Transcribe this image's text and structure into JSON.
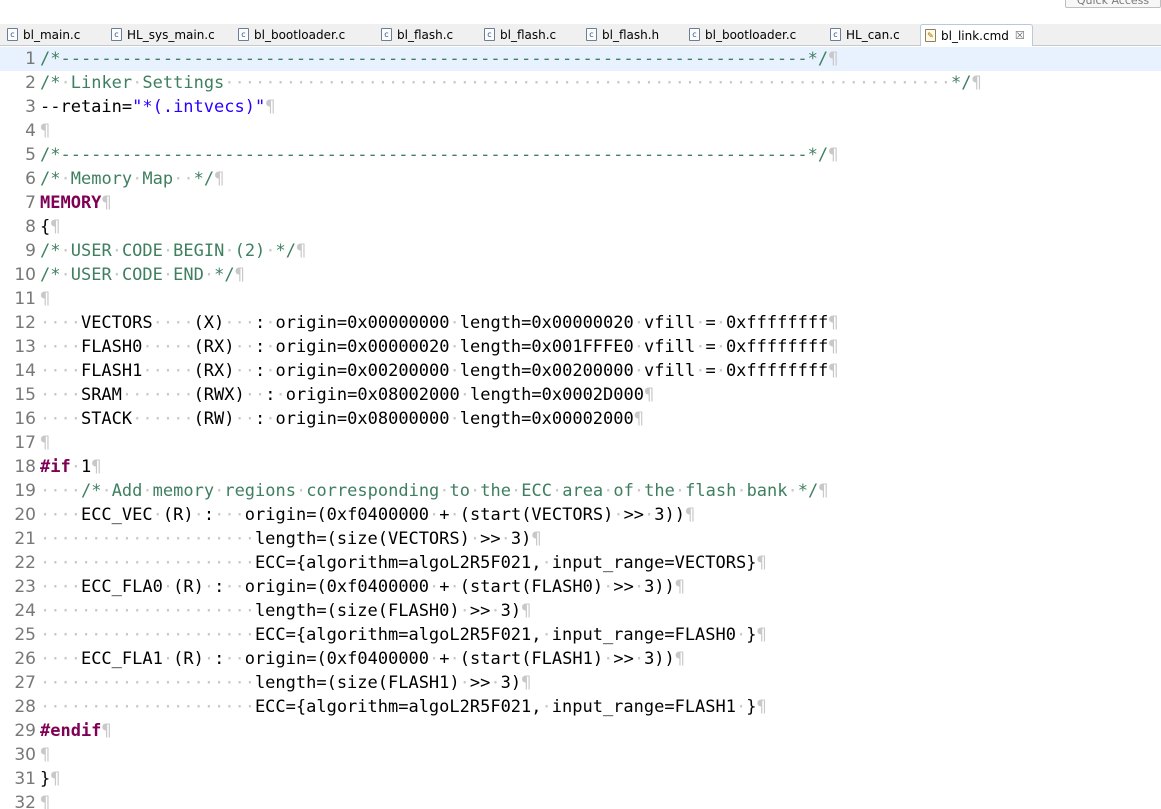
{
  "quick_access": {
    "label": "Quick Access"
  },
  "tabs": [
    {
      "label": "bl_main.c",
      "type": "c"
    },
    {
      "label": "HL_sys_main.c",
      "type": "c"
    },
    {
      "label": "bl_bootloader.c",
      "type": "c"
    },
    {
      "label": "bl_flash.c",
      "type": "c"
    },
    {
      "label": "bl_flash.c",
      "type": "c"
    },
    {
      "label": "bl_flash.h",
      "type": "h"
    },
    {
      "label": "bl_bootloader.c",
      "type": "c"
    },
    {
      "label": "HL_can.c",
      "type": "c"
    },
    {
      "label": "bl_link.cmd",
      "type": "cmd",
      "active": true,
      "close": "☒"
    }
  ],
  "colors": {
    "comment": "#3f7f5f",
    "keyword": "#7f0055",
    "string": "#2a00ff",
    "whitespace_marker": "#c8c8c8",
    "line_number": "#787878",
    "current_line": "#e8f2fe"
  },
  "editor": {
    "lines": [
      {
        "n": "1",
        "segs": [
          [
            "/*-------------------------------------------------------------------------*/",
            "cm"
          ]
        ]
      },
      {
        "n": "2",
        "segs": [
          [
            "/*",
            "cm"
          ],
          [
            "·",
            "ws"
          ],
          [
            "Linker",
            "cm"
          ],
          [
            "·",
            "ws"
          ],
          [
            "Settings",
            "cm"
          ],
          [
            "·······································································",
            "ws"
          ],
          [
            "*/",
            "cm"
          ]
        ]
      },
      {
        "n": "3",
        "segs": [
          [
            "--retain=",
            ""
          ],
          [
            "\"*(.intvecs)\"",
            "str"
          ]
        ]
      },
      {
        "n": "4",
        "segs": []
      },
      {
        "n": "5",
        "segs": [
          [
            "/*-------------------------------------------------------------------------*/",
            "cm"
          ]
        ]
      },
      {
        "n": "6",
        "segs": [
          [
            "/*",
            "cm"
          ],
          [
            "·",
            "ws"
          ],
          [
            "Memory",
            "cm"
          ],
          [
            "·",
            "ws"
          ],
          [
            "Map",
            "cm"
          ],
          [
            "··",
            "ws"
          ],
          [
            "*/",
            "cm"
          ]
        ]
      },
      {
        "n": "7",
        "segs": [
          [
            "MEMORY",
            "kw"
          ]
        ]
      },
      {
        "n": "8",
        "segs": [
          [
            "{",
            ""
          ]
        ]
      },
      {
        "n": "9",
        "segs": [
          [
            "/*",
            "cm"
          ],
          [
            "·",
            "ws"
          ],
          [
            "USER",
            "cm"
          ],
          [
            "·",
            "ws"
          ],
          [
            "CODE",
            "cm"
          ],
          [
            "·",
            "ws"
          ],
          [
            "BEGIN",
            "cm"
          ],
          [
            "·",
            "ws"
          ],
          [
            "(2)",
            "cm"
          ],
          [
            "·",
            "ws"
          ],
          [
            "*/",
            "cm"
          ]
        ]
      },
      {
        "n": "10",
        "segs": [
          [
            "/*",
            "cm"
          ],
          [
            "·",
            "ws"
          ],
          [
            "USER",
            "cm"
          ],
          [
            "·",
            "ws"
          ],
          [
            "CODE",
            "cm"
          ],
          [
            "·",
            "ws"
          ],
          [
            "END",
            "cm"
          ],
          [
            "·",
            "ws"
          ],
          [
            "*/",
            "cm"
          ]
        ]
      },
      {
        "n": "11",
        "segs": []
      },
      {
        "n": "12",
        "segs": [
          [
            "····",
            "ws"
          ],
          [
            "VECTORS",
            ""
          ],
          [
            "····",
            "ws"
          ],
          [
            "(X)",
            ""
          ],
          [
            "···",
            "ws"
          ],
          [
            ":",
            ""
          ],
          [
            "·",
            "ws"
          ],
          [
            "origin=0x00000000",
            ""
          ],
          [
            "·",
            "ws"
          ],
          [
            "length=0x00000020",
            ""
          ],
          [
            "·",
            "ws"
          ],
          [
            "vfill",
            ""
          ],
          [
            "·",
            "ws"
          ],
          [
            "=",
            ""
          ],
          [
            "·",
            "ws"
          ],
          [
            "0xffffffff",
            ""
          ]
        ]
      },
      {
        "n": "13",
        "segs": [
          [
            "····",
            "ws"
          ],
          [
            "FLASH0",
            ""
          ],
          [
            "·····",
            "ws"
          ],
          [
            "(RX)",
            ""
          ],
          [
            "··",
            "ws"
          ],
          [
            ":",
            ""
          ],
          [
            "·",
            "ws"
          ],
          [
            "origin=0x00000020",
            ""
          ],
          [
            "·",
            "ws"
          ],
          [
            "length=0x001FFFE0",
            ""
          ],
          [
            "·",
            "ws"
          ],
          [
            "vfill",
            ""
          ],
          [
            "·",
            "ws"
          ],
          [
            "=",
            ""
          ],
          [
            "·",
            "ws"
          ],
          [
            "0xffffffff",
            ""
          ]
        ]
      },
      {
        "n": "14",
        "segs": [
          [
            "····",
            "ws"
          ],
          [
            "FLASH1",
            ""
          ],
          [
            "·····",
            "ws"
          ],
          [
            "(RX)",
            ""
          ],
          [
            "··",
            "ws"
          ],
          [
            ":",
            ""
          ],
          [
            "·",
            "ws"
          ],
          [
            "origin=0x00200000",
            ""
          ],
          [
            "·",
            "ws"
          ],
          [
            "length=0x00200000",
            ""
          ],
          [
            "·",
            "ws"
          ],
          [
            "vfill",
            ""
          ],
          [
            "·",
            "ws"
          ],
          [
            "=",
            ""
          ],
          [
            "·",
            "ws"
          ],
          [
            "0xffffffff",
            ""
          ]
        ]
      },
      {
        "n": "15",
        "segs": [
          [
            "····",
            "ws"
          ],
          [
            "SRAM",
            ""
          ],
          [
            "·······",
            "ws"
          ],
          [
            "(RWX)",
            ""
          ],
          [
            "··",
            "ws"
          ],
          [
            ":",
            ""
          ],
          [
            "·",
            "ws"
          ],
          [
            "origin=0x08002000",
            ""
          ],
          [
            "·",
            "ws"
          ],
          [
            "length=0x0002D000",
            ""
          ]
        ]
      },
      {
        "n": "16",
        "segs": [
          [
            "····",
            "ws"
          ],
          [
            "STACK",
            ""
          ],
          [
            "······",
            "ws"
          ],
          [
            "(RW)",
            ""
          ],
          [
            "··",
            "ws"
          ],
          [
            ":",
            ""
          ],
          [
            "·",
            "ws"
          ],
          [
            "origin=0x08000000",
            ""
          ],
          [
            "·",
            "ws"
          ],
          [
            "length=0x00002000",
            ""
          ]
        ]
      },
      {
        "n": "17",
        "segs": []
      },
      {
        "n": "18",
        "segs": [
          [
            "#if",
            "kw"
          ],
          [
            "·",
            "ws"
          ],
          [
            "1",
            ""
          ]
        ]
      },
      {
        "n": "19",
        "segs": [
          [
            "····",
            "ws"
          ],
          [
            "/*",
            "cm"
          ],
          [
            "·",
            "ws"
          ],
          [
            "Add",
            "cm"
          ],
          [
            "·",
            "ws"
          ],
          [
            "memory",
            "cm"
          ],
          [
            "·",
            "ws"
          ],
          [
            "regions",
            "cm"
          ],
          [
            "·",
            "ws"
          ],
          [
            "corresponding",
            "cm"
          ],
          [
            "·",
            "ws"
          ],
          [
            "to",
            "cm"
          ],
          [
            "·",
            "ws"
          ],
          [
            "the",
            "cm"
          ],
          [
            "·",
            "ws"
          ],
          [
            "ECC",
            "cm"
          ],
          [
            "·",
            "ws"
          ],
          [
            "area",
            "cm"
          ],
          [
            "·",
            "ws"
          ],
          [
            "of",
            "cm"
          ],
          [
            "·",
            "ws"
          ],
          [
            "the",
            "cm"
          ],
          [
            "·",
            "ws"
          ],
          [
            "flash",
            "cm"
          ],
          [
            "·",
            "ws"
          ],
          [
            "bank",
            "cm"
          ],
          [
            "·",
            "ws"
          ],
          [
            "*/",
            "cm"
          ]
        ]
      },
      {
        "n": "20",
        "segs": [
          [
            "····",
            "ws"
          ],
          [
            "ECC_VEC",
            ""
          ],
          [
            "·",
            "ws"
          ],
          [
            "(R)",
            ""
          ],
          [
            "·",
            "ws"
          ],
          [
            ":",
            ""
          ],
          [
            "···",
            "ws"
          ],
          [
            "origin=(0xf0400000",
            ""
          ],
          [
            "·",
            "ws"
          ],
          [
            "+",
            ""
          ],
          [
            "·",
            "ws"
          ],
          [
            "(start(VECTORS)",
            ""
          ],
          [
            "·",
            "ws"
          ],
          [
            ">>",
            ""
          ],
          [
            "·",
            "ws"
          ],
          [
            "3))",
            ""
          ]
        ]
      },
      {
        "n": "21",
        "segs": [
          [
            "·····················",
            "ws"
          ],
          [
            "length=(size(VECTORS)",
            ""
          ],
          [
            "·",
            "ws"
          ],
          [
            ">>",
            ""
          ],
          [
            "·",
            "ws"
          ],
          [
            "3)",
            ""
          ]
        ]
      },
      {
        "n": "22",
        "segs": [
          [
            "·····················",
            "ws"
          ],
          [
            "ECC={algorithm=algoL2R5F021,",
            ""
          ],
          [
            "·",
            "ws"
          ],
          [
            "input_range=VECTORS}",
            ""
          ]
        ]
      },
      {
        "n": "23",
        "segs": [
          [
            "····",
            "ws"
          ],
          [
            "ECC_FLA0",
            ""
          ],
          [
            "·",
            "ws"
          ],
          [
            "(R)",
            ""
          ],
          [
            "·",
            "ws"
          ],
          [
            ":",
            ""
          ],
          [
            "··",
            "ws"
          ],
          [
            "origin=(0xf0400000",
            ""
          ],
          [
            "·",
            "ws"
          ],
          [
            "+",
            ""
          ],
          [
            "·",
            "ws"
          ],
          [
            "(start(FLASH0)",
            ""
          ],
          [
            "·",
            "ws"
          ],
          [
            ">>",
            ""
          ],
          [
            "·",
            "ws"
          ],
          [
            "3))",
            ""
          ]
        ]
      },
      {
        "n": "24",
        "segs": [
          [
            "·····················",
            "ws"
          ],
          [
            "length=(size(FLASH0)",
            ""
          ],
          [
            "·",
            "ws"
          ],
          [
            ">>",
            ""
          ],
          [
            "·",
            "ws"
          ],
          [
            "3)",
            ""
          ]
        ]
      },
      {
        "n": "25",
        "segs": [
          [
            "·····················",
            "ws"
          ],
          [
            "ECC={algorithm=algoL2R5F021,",
            ""
          ],
          [
            "·",
            "ws"
          ],
          [
            "input_range=FLASH0",
            ""
          ],
          [
            "·",
            "ws"
          ],
          [
            "}",
            ""
          ]
        ]
      },
      {
        "n": "26",
        "segs": [
          [
            "····",
            "ws"
          ],
          [
            "ECC_FLA1",
            ""
          ],
          [
            "·",
            "ws"
          ],
          [
            "(R)",
            ""
          ],
          [
            "·",
            "ws"
          ],
          [
            ":",
            ""
          ],
          [
            "··",
            "ws"
          ],
          [
            "origin=(0xf0400000",
            ""
          ],
          [
            "·",
            "ws"
          ],
          [
            "+",
            ""
          ],
          [
            "·",
            "ws"
          ],
          [
            "(start(FLASH1)",
            ""
          ],
          [
            "·",
            "ws"
          ],
          [
            ">>",
            ""
          ],
          [
            "·",
            "ws"
          ],
          [
            "3))",
            ""
          ]
        ]
      },
      {
        "n": "27",
        "segs": [
          [
            "·····················",
            "ws"
          ],
          [
            "length=(size(FLASH1)",
            ""
          ],
          [
            "·",
            "ws"
          ],
          [
            ">>",
            ""
          ],
          [
            "·",
            "ws"
          ],
          [
            "3)",
            ""
          ]
        ]
      },
      {
        "n": "28",
        "segs": [
          [
            "·····················",
            "ws"
          ],
          [
            "ECC={algorithm=algoL2R5F021,",
            ""
          ],
          [
            "·",
            "ws"
          ],
          [
            "input_range=FLASH1",
            ""
          ],
          [
            "·",
            "ws"
          ],
          [
            "}",
            ""
          ]
        ]
      },
      {
        "n": "29",
        "segs": [
          [
            "#endif",
            "kw"
          ]
        ]
      },
      {
        "n": "30",
        "segs": []
      },
      {
        "n": "31",
        "segs": [
          [
            "}",
            ""
          ]
        ]
      },
      {
        "n": "32",
        "segs": []
      }
    ],
    "eol_marker": "¶"
  }
}
